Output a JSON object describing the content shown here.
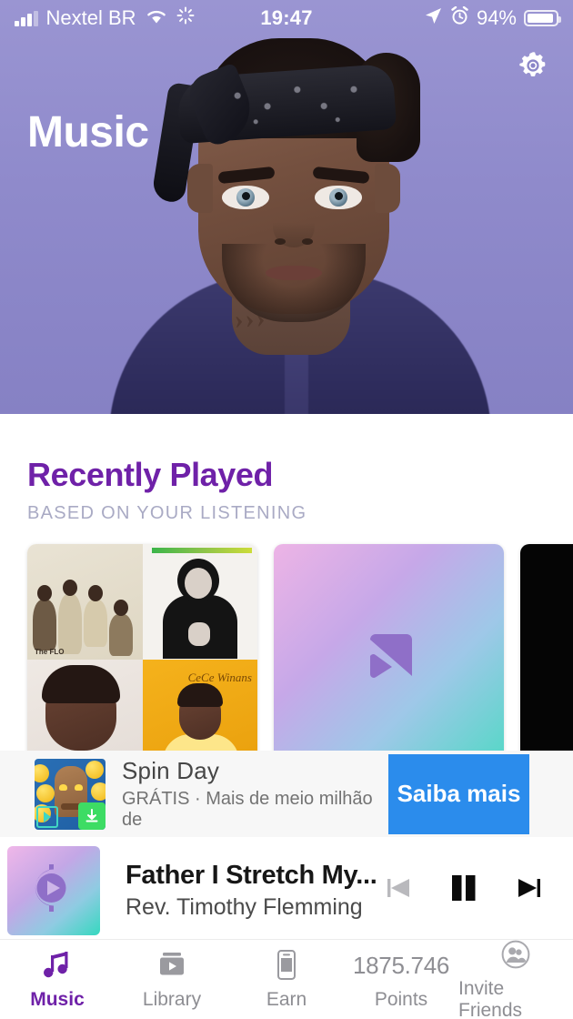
{
  "statusbar": {
    "carrier": "Nextel BR",
    "time": "19:47",
    "battery_pct": "94%",
    "icons": [
      "signal-bars-icon",
      "wifi-icon",
      "sync-spinner-icon",
      "location-arrow-icon",
      "alarm-clock-icon",
      "battery-icon"
    ]
  },
  "hero": {
    "title": "Music",
    "settings_icon": "gear-icon",
    "background_color": "#8b86c8"
  },
  "section": {
    "title": "Recently Played",
    "subtitle": "BASED ON YOUR LISTENING",
    "title_color": "#6f21a8",
    "subtitle_color": "#a9aac4",
    "cards": [
      {
        "id": "album-collage",
        "type": "collage",
        "labels": {
          "q1": "The FLO",
          "q3": "CeCe Winans",
          "q4": "CeCe Winans"
        }
      },
      {
        "id": "gradient-logo",
        "type": "gradient",
        "logo": "play-flag-logo"
      },
      {
        "id": "black-album",
        "type": "solid",
        "color": "#050505"
      }
    ]
  },
  "ad": {
    "title": "Spin Day",
    "subtitle": "GRÁTIS · Mais de meio milhão de",
    "cta": "Saiba mais",
    "cta_color": "#2b8cec",
    "icon": "tiki-game-icon"
  },
  "nowplaying": {
    "track": "Father I Stretch My...",
    "artist": "Rev. Timothy Flemming",
    "artwork": "cent-play-logo",
    "controls": {
      "previous": "skip-previous-icon",
      "playpause": "pause-icon",
      "next": "skip-next-icon"
    }
  },
  "tabbar": {
    "active": "Music",
    "active_color": "#6f21a8",
    "inactive_color": "#8e8e93",
    "items": [
      {
        "label": "Music",
        "icon": "music-note-icon"
      },
      {
        "label": "Library",
        "icon": "library-video-icon"
      },
      {
        "label": "Earn",
        "icon": "phone-device-icon"
      },
      {
        "label": "Points",
        "icon": "points-value",
        "value": "1875.746"
      },
      {
        "label": "Invite Friends",
        "icon": "people-circle-icon"
      }
    ]
  }
}
